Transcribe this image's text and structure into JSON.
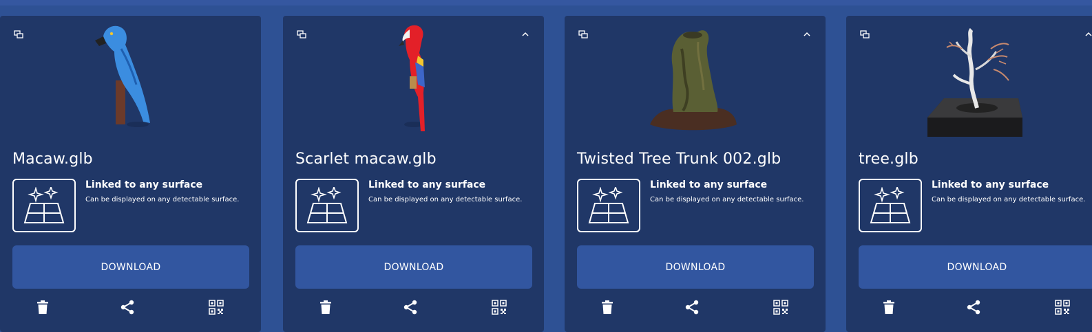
{
  "models": [
    {
      "name": "Scarlet macaw.glb",
      "link_title": "Linked to any surface",
      "link_desc": "Can be displayed on any detectable surface.",
      "download_label": "DOWNLOAD",
      "thumbnail": "scarlet-macaw"
    },
    {
      "name": "Twisted Tree Trunk 002.glb",
      "link_title": "Linked to any surface",
      "link_desc": "Can be displayed on any detectable surface.",
      "download_label": "DOWNLOAD",
      "thumbnail": "tree-trunk"
    },
    {
      "name": "tree.glb",
      "link_title": "Linked to any surface",
      "link_desc": "Can be displayed on any detectable surface.",
      "download_label": "DOWNLOAD",
      "thumbnail": "bonsai-tree"
    },
    {
      "name": "Macaw.glb",
      "link_title": "Linked to any surface",
      "link_desc": "Can be displayed on any detectable surface.",
      "download_label": "DOWNLOAD",
      "thumbnail": "blue-macaw"
    }
  ],
  "icons": {
    "chat": "chat-icon",
    "collapse": "chevron-up-icon",
    "surface": "surface-sparkle-icon",
    "delete": "trash-icon",
    "share": "share-icon",
    "qr": "qr-code-icon"
  },
  "colors": {
    "page_bg": "#2e5194",
    "card_bg": "#203767",
    "button_bg": "#3256a0",
    "text": "#ffffff"
  }
}
